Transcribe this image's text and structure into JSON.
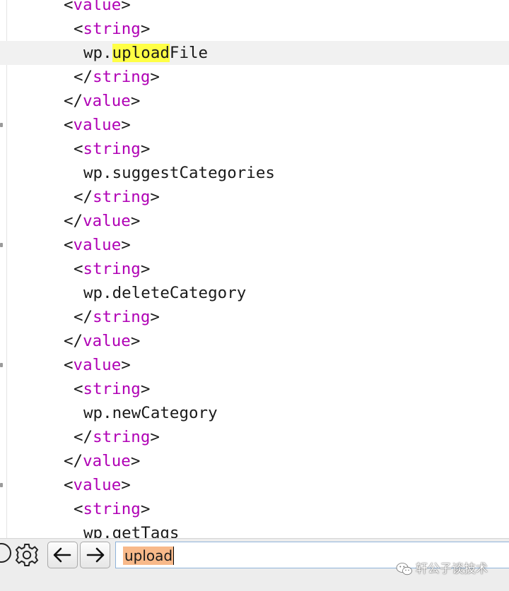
{
  "code": {
    "current_line_index": 2,
    "lines": [
      {
        "kind": "tag",
        "indent": "    ",
        "slash": "",
        "name": "value"
      },
      {
        "kind": "tag",
        "indent": "     ",
        "slash": "",
        "name": "string"
      },
      {
        "kind": "text",
        "indent": "      ",
        "before": "wp.",
        "match": "upload",
        "after": "File"
      },
      {
        "kind": "tag",
        "indent": "     ",
        "slash": "/",
        "name": "string"
      },
      {
        "kind": "tag",
        "indent": "    ",
        "slash": "/",
        "name": "value"
      },
      {
        "kind": "tag",
        "indent": "    ",
        "slash": "",
        "name": "value"
      },
      {
        "kind": "tag",
        "indent": "     ",
        "slash": "",
        "name": "string"
      },
      {
        "kind": "text",
        "indent": "      ",
        "before": "wp.suggestCategories",
        "match": "",
        "after": ""
      },
      {
        "kind": "tag",
        "indent": "     ",
        "slash": "/",
        "name": "string"
      },
      {
        "kind": "tag",
        "indent": "    ",
        "slash": "/",
        "name": "value"
      },
      {
        "kind": "tag",
        "indent": "    ",
        "slash": "",
        "name": "value"
      },
      {
        "kind": "tag",
        "indent": "     ",
        "slash": "",
        "name": "string"
      },
      {
        "kind": "text",
        "indent": "      ",
        "before": "wp.deleteCategory",
        "match": "",
        "after": ""
      },
      {
        "kind": "tag",
        "indent": "     ",
        "slash": "/",
        "name": "string"
      },
      {
        "kind": "tag",
        "indent": "    ",
        "slash": "/",
        "name": "value"
      },
      {
        "kind": "tag",
        "indent": "    ",
        "slash": "",
        "name": "value"
      },
      {
        "kind": "tag",
        "indent": "     ",
        "slash": "",
        "name": "string"
      },
      {
        "kind": "text",
        "indent": "      ",
        "before": "wp.newCategory",
        "match": "",
        "after": ""
      },
      {
        "kind": "tag",
        "indent": "     ",
        "slash": "/",
        "name": "string"
      },
      {
        "kind": "tag",
        "indent": "    ",
        "slash": "/",
        "name": "value"
      },
      {
        "kind": "tag",
        "indent": "    ",
        "slash": "",
        "name": "value"
      },
      {
        "kind": "tag",
        "indent": "     ",
        "slash": "",
        "name": "string"
      },
      {
        "kind": "text",
        "indent": "      ",
        "before": "wp.getTags",
        "match": "",
        "after": ""
      }
    ]
  },
  "find_bar": {
    "query": "upload",
    "icons": {
      "help": "help-circle-icon",
      "settings": "gear-icon",
      "previous": "arrow-left-icon",
      "next": "arrow-right-icon"
    }
  },
  "watermark": {
    "text": "轩公子谈技术",
    "icon": "wechat-icon"
  },
  "colors": {
    "tag_name": "#b000b5",
    "text": "#1a1a1a",
    "match_highlight": "#ffff45",
    "search_highlight": "#f8b98a",
    "current_line": "#f1f1f1"
  }
}
